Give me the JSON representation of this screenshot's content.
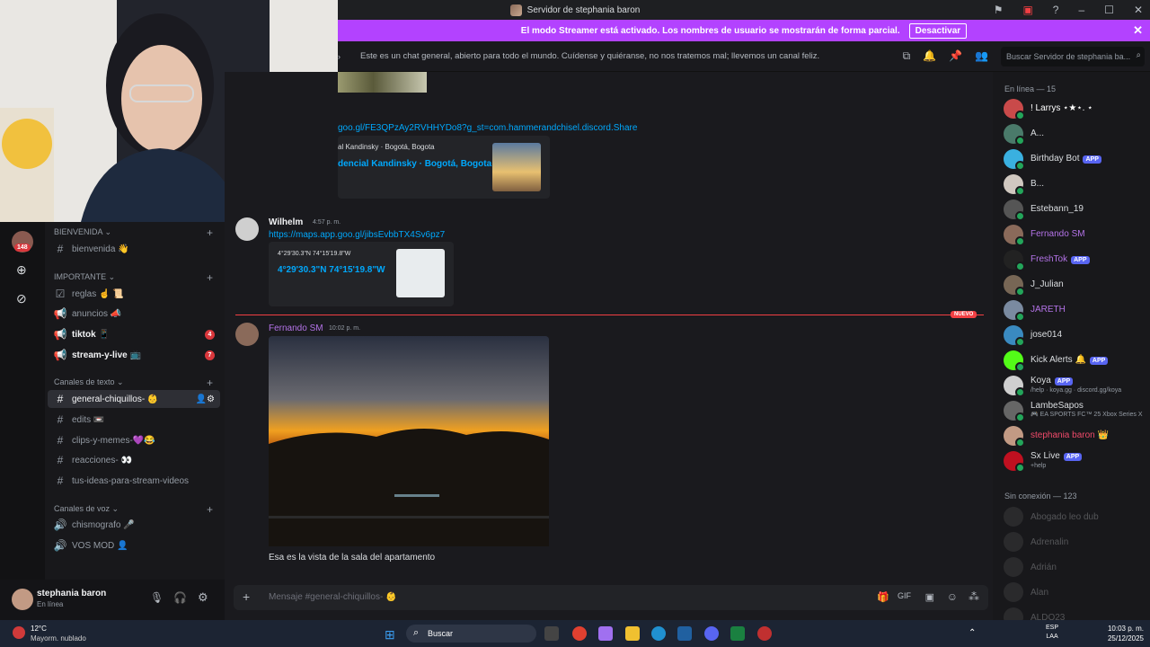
{
  "window": {
    "title": "Servidor de stephania baron"
  },
  "banner": {
    "text": "El modo Streamer está activado. Los nombres de usuario se mostrarán de forma parcial.",
    "button": "Desactivar"
  },
  "channel_header": {
    "topic": "Este es un chat general, abierto para todo el mundo. Cuídense y quiéranse, no nos tratemos mal; llevemos un canal feliz.",
    "search_placeholder": "Buscar Servidor de stephania ba..."
  },
  "server_rail": {
    "notif_count": "148"
  },
  "sidebar": {
    "categories": [
      {
        "label": "BIENVENIDA",
        "channels": [
          {
            "name": "bienvenida 👋",
            "icon": "hash"
          }
        ]
      },
      {
        "label": "IMPORTANTE",
        "channels": [
          {
            "name": "reglas ☝️ 📜",
            "icon": "rules"
          },
          {
            "name": "anuncios 📣",
            "icon": "megaphone"
          },
          {
            "name": "tiktok 📱",
            "icon": "megaphone",
            "badge": "4"
          },
          {
            "name": "stream-y-live 📺",
            "icon": "megaphone",
            "badge": "7"
          }
        ]
      },
      {
        "label": "Canales de texto",
        "channels": [
          {
            "name": "general-chiquillos- 👶",
            "icon": "hash"
          },
          {
            "name": "edits 📼",
            "icon": "hash"
          },
          {
            "name": "clips-y-memes-💜😂",
            "icon": "hash"
          },
          {
            "name": "reacciones- 👀",
            "icon": "hash"
          },
          {
            "name": "tus-ideas-para-stream-videos",
            "icon": "hash"
          }
        ]
      },
      {
        "label": "Canales de voz",
        "channels": [
          {
            "name": "chismografo 🎤",
            "icon": "speaker"
          },
          {
            "name": "VOS MOD 👤",
            "icon": "speaker"
          }
        ]
      }
    ]
  },
  "user_panel": {
    "name": "stephania baron",
    "status": "En línea"
  },
  "chat": {
    "link1": "goo.gl/FE3QPzAy2RVHHYDo8?g_st=com.hammerandchisel.discord.Share",
    "embed1_small": "al Kandinsky · Bogotá, Bogota",
    "embed1_title": "dencial Kandinsky · Bogotá, Bogota",
    "author_partial": "Wilhelm",
    "time_partial": "4:57 p. m.",
    "link2": "https://maps.app.goo.gl/jibsEvbbTX4Sv6pz7",
    "embed2_small": "4°29'30.3\"N 74°15'19.8\"W",
    "embed2_title": "4°29'30.3\"N 74°15'19.8\"W",
    "new_label": "NUEVO",
    "msg_author": "Fernando SM",
    "msg_time": "10:02 p. m.",
    "msg_text": "Esa es la vista de la sala del apartamento",
    "composer_placeholder": "Mensaje #general-chiquillos- 👶"
  },
  "members": {
    "online_header": "En línea — 15",
    "online": [
      {
        "name": "! Larrys ⋆★⋆. ⋆",
        "color": "#ffffff",
        "av": "#c94a4a"
      },
      {
        "name": "A...",
        "color": "#dbdee1",
        "av": "#4a7a6a"
      },
      {
        "name": "Birthday Bot",
        "color": "#dbdee1",
        "av": "#3ab0e0",
        "app": "APP"
      },
      {
        "name": "B...",
        "color": "#dbdee1",
        "av": "#d0c8c0"
      },
      {
        "name": "Estebann_19",
        "color": "#dbdee1",
        "av": "#555"
      },
      {
        "name": "Fernando SM",
        "color": "#b473e8",
        "av": "#8a6a5a"
      },
      {
        "name": "FreshTok",
        "color": "#b473e8",
        "av": "#222",
        "app": "APP"
      },
      {
        "name": "J_Julian",
        "color": "#dbdee1",
        "av": "#776655"
      },
      {
        "name": "JARETH",
        "color": "#b473e8",
        "av": "#7a8aa0"
      },
      {
        "name": "jose014",
        "color": "#dbdee1",
        "av": "#3a8ac0"
      },
      {
        "name": "Kick Alerts 🔔",
        "color": "#dbdee1",
        "av": "#53fc18",
        "app": "APP"
      },
      {
        "name": "Koya",
        "color": "#dbdee1",
        "av": "#cfcfcf",
        "app": "APP",
        "sub": "/help · koya.gg · discord.gg/koya"
      },
      {
        "name": "LambeSapos",
        "color": "#dbdee1",
        "av": "#666",
        "sub": "🎮 EA SPORTS FC™ 25 Xbox Series X"
      },
      {
        "name": "stephania baron 👑",
        "color": "#f04a6a",
        "av": "#c29a84"
      },
      {
        "name": "Sx Live",
        "color": "#dbdee1",
        "av": "#c01020",
        "app": "APP",
        "sub": "+help"
      }
    ],
    "offline_header": "Sin conexión — 123",
    "offline": [
      {
        "name": "Abogado leo dub"
      },
      {
        "name": "Adrenalin"
      },
      {
        "name": "Adrián"
      },
      {
        "name": "Alan"
      },
      {
        "name": "ALDO23"
      }
    ]
  },
  "taskbar": {
    "weather_temp": "12°C",
    "weather_desc": "Mayorm. nublado",
    "search_label": "Buscar",
    "lang1": "ESP",
    "lang2": "LAA",
    "time": "10:03 p. m.",
    "date": "25/12/2025"
  }
}
